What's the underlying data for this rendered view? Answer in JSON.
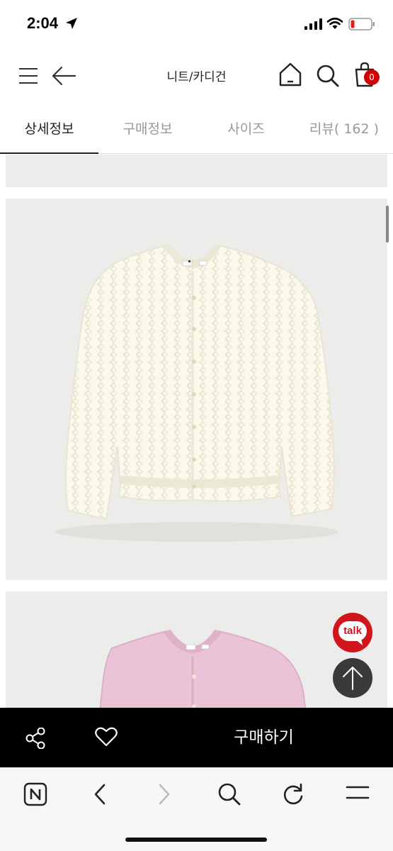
{
  "status": {
    "time": "2:04"
  },
  "header": {
    "title": "니트/카디건",
    "cart_count": "0"
  },
  "tabs": [
    {
      "label": "상세정보"
    },
    {
      "label": "구매정보"
    },
    {
      "label": "사이즈"
    },
    {
      "label": "리뷰( 162 )"
    }
  ],
  "floating": {
    "talk_label": "talk"
  },
  "action_bar": {
    "buy_label": "구매하기"
  },
  "colors": {
    "accent_red": "#d60000",
    "talk_red": "#d1151d",
    "cardigan_ivory": "#fbf9ec",
    "cardigan_pink": "#eac3d6"
  },
  "icons": [
    "location-arrow-icon",
    "signal-icon",
    "wifi-icon",
    "battery-icon",
    "menu-icon",
    "back-arrow-icon",
    "home-icon",
    "search-icon",
    "shopping-bag-icon",
    "share-icon",
    "heart-icon",
    "arrow-up-icon",
    "naver-icon",
    "chevron-left-icon",
    "chevron-right-icon",
    "reload-icon",
    "hamburger-icon"
  ]
}
